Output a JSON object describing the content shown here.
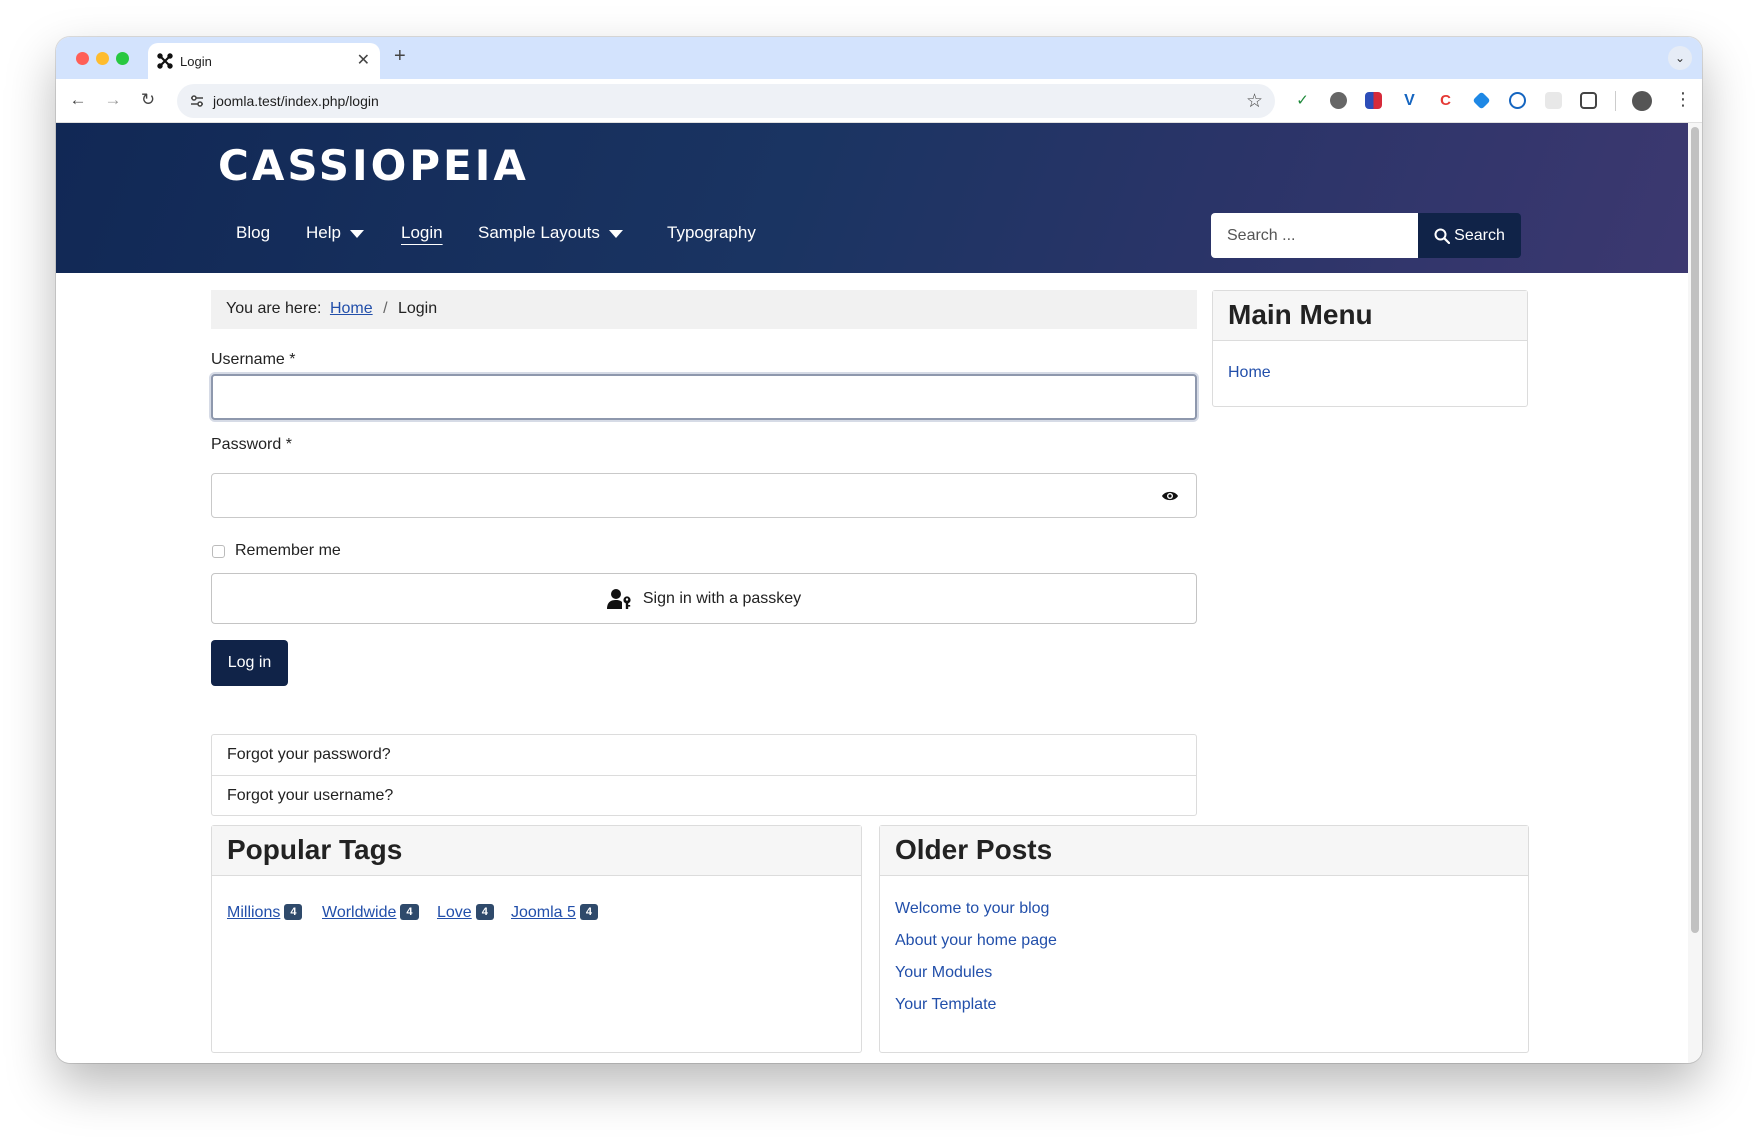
{
  "browser": {
    "tab_title": "Login",
    "url": "joomla.test/index.php/login"
  },
  "site": {
    "brand": "CASSIOPEIA",
    "nav": [
      {
        "label": "Blog"
      },
      {
        "label": "Help",
        "has_dropdown": true
      },
      {
        "label": "Login",
        "active": true
      },
      {
        "label": "Sample Layouts",
        "has_dropdown": true
      },
      {
        "label": "Typography"
      }
    ],
    "search_placeholder": "Search ...",
    "search_button": "Search"
  },
  "breadcrumb": {
    "prefix": "You are here:",
    "home": "Home",
    "separator": "/",
    "current": "Login"
  },
  "login_form": {
    "username_label": "Username *",
    "password_label": "Password *",
    "remember_label": "Remember me",
    "passkey_button": "Sign in with a passkey",
    "login_button": "Log in",
    "forgot_password": "Forgot your password?",
    "forgot_username": "Forgot your username?"
  },
  "main_menu": {
    "title": "Main Menu",
    "items": [
      "Home"
    ]
  },
  "popular_tags": {
    "title": "Popular Tags",
    "tags": [
      {
        "name": "Millions",
        "count": "4"
      },
      {
        "name": "Worldwide",
        "count": "4"
      },
      {
        "name": "Love",
        "count": "4"
      },
      {
        "name": "Joomla 5",
        "count": "4"
      }
    ]
  },
  "older_posts": {
    "title": "Older Posts",
    "items": [
      "Welcome to your blog",
      "About your home page",
      "Your Modules",
      "Your Template"
    ]
  },
  "colors": {
    "header_start": "#112855",
    "header_end": "#3c3870",
    "primary_button": "#102348",
    "link": "#224faa"
  }
}
